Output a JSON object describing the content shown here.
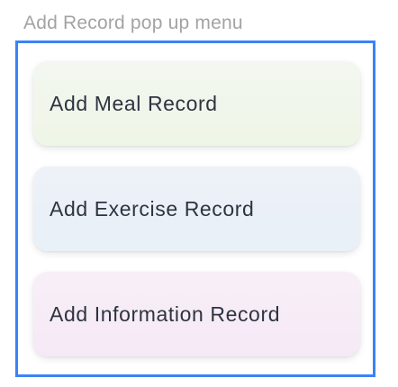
{
  "caption": "Add Record pop up menu",
  "menu": {
    "items": [
      {
        "label": "Add Meal Record",
        "color": "#eef6e6"
      },
      {
        "label": "Add Exercise Record",
        "color": "#e8f0f8"
      },
      {
        "label": "Add Information Record",
        "color": "#f6e9f6"
      }
    ],
    "frame_color": "#3b82f6"
  }
}
